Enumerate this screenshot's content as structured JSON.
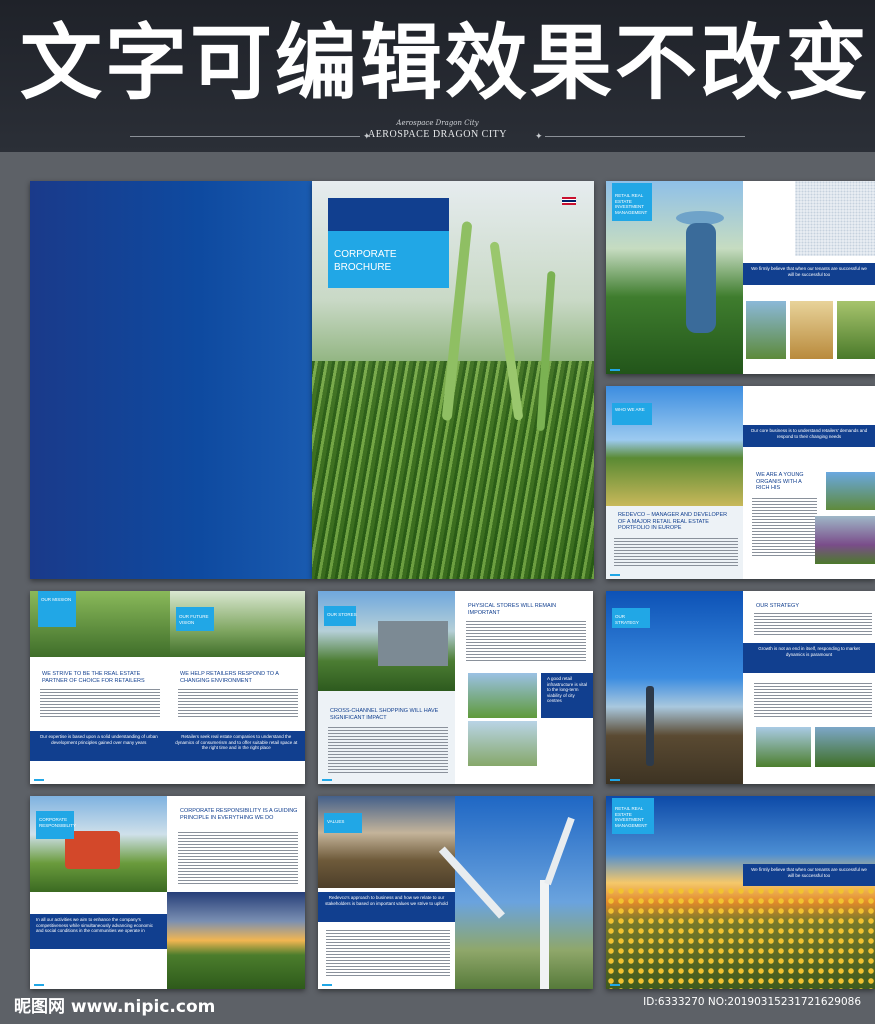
{
  "banner": {
    "title": "文字可编辑效果不改变",
    "script_subtitle": "Aerospace Dragon City",
    "subtitle": "AEROSPACE DRAGON CITY"
  },
  "cover": {
    "title": "CORPORATE BROCHURE"
  },
  "spread_a": {
    "label": "RETAIL REAL ESTATE INVESTMENT MANAGEMENT",
    "quote": "We firmly believe that when our tenants are successful we will be successful too"
  },
  "spread_b": {
    "label": "WHO WE ARE",
    "quote": "Our core business is to understand retailers' demands and respond to their changing needs",
    "heading_right": "WE ARE A YOUNG ORGANIS WITH A RICH HIS",
    "heading_left": "REDEVCO – MANAGER AND DEVELOPER OF A MAJOR RETAIL REAL ESTATE PORTFOLIO IN EUROPE"
  },
  "spread_c": {
    "label_left": "OUR MISSION",
    "label_right": "OUR FUTURE VISION",
    "heading_left": "WE STRIVE TO BE THE REAL ESTATE PARTNER OF CHOICE FOR RETAILERS",
    "heading_right": "WE HELP RETAILERS RESPOND TO A CHANGING ENVIRONMENT",
    "quote_left": "Our expertise is based upon a solid understanding of urban development principles gained over many years",
    "quote_right": "Retailers seek real estate companies to understand the dynamics of consumerism and to offer suitable retail space at the right time and in the right place"
  },
  "spread_d": {
    "label": "OUR STORES",
    "heading_top": "PHYSICAL STORES WILL REMAIN IMPORTANT",
    "heading_bottom": "CROSS-CHANNEL SHOPPING WILL HAVE SIGNIFICANT IMPACT",
    "quote": "A good retail infrastructure is vital to the long-term viability of city centres"
  },
  "spread_e": {
    "label": "OUR STRATEGY",
    "heading": "OUR STRATEGY",
    "quote": "Growth is not an end in itself, responding to market dynamics is paramount"
  },
  "spread_f": {
    "label": "CORPORATE RESPONSIBILITY",
    "heading": "CORPORATE RESPONSIBILITY IS A GUIDING PRINCIPLE IN EVERYTHING WE DO",
    "quote": "In all our activities we aim to enhance the company's competitiveness while simultaneously advancing economic and social conditions in the communities we operate in"
  },
  "spread_g": {
    "label": "VALUES",
    "quote": "Redevco's approach to business and how we relate to our stakeholders is based on important values we strive to uphold"
  },
  "spread_h": {
    "label": "RETAIL REAL ESTATE INVESTMENT MANAGEMENT",
    "quote": "We firmly believe that when our tenants are successful we will be successful too"
  },
  "watermark": {
    "left": "昵图网 www.nipic.com",
    "right": "ID:6333270 NO:20190315231721629086"
  },
  "colors": {
    "navy": "#113f8f",
    "accent": "#21a7e6",
    "banner_bg": "#1f2229",
    "page_bg": "#5d6167"
  }
}
